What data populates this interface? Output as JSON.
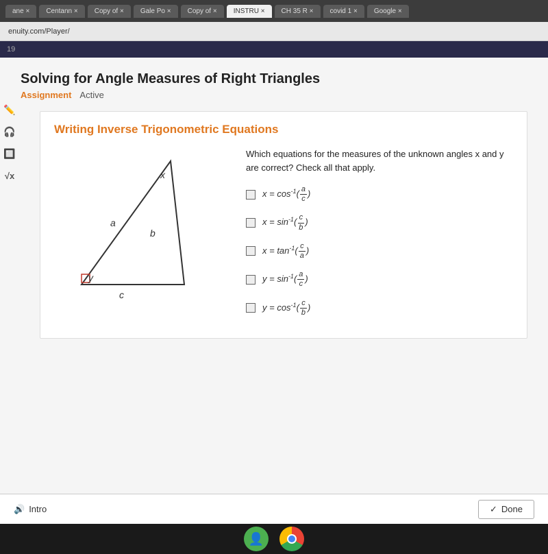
{
  "browser": {
    "tabs": [
      {
        "label": "ane",
        "active": false
      },
      {
        "label": "Centann",
        "active": false
      },
      {
        "label": "Copy of",
        "active": false
      },
      {
        "label": "Gale Po",
        "active": false
      },
      {
        "label": "Copy of",
        "active": false
      },
      {
        "label": "INSTRU",
        "active": false
      },
      {
        "label": "CH 35 R",
        "active": false
      },
      {
        "label": "covid 1",
        "active": false
      },
      {
        "label": "Google",
        "active": false
      }
    ],
    "address": "enuity.com/Player/"
  },
  "page": {
    "number": "19",
    "title": "Solving for Angle Measures of Right Triangles",
    "assignment_label": "Assignment",
    "active_label": "Active"
  },
  "card": {
    "heading": "Writing Inverse Trigonometric Equations",
    "question": "Which equations for the measures of the unknown angles x and y are correct? Check all that apply.",
    "answers": [
      {
        "id": 1,
        "text": "x = cos⁻¹(a/c)"
      },
      {
        "id": 2,
        "text": "x = sin⁻¹(c/b)"
      },
      {
        "id": 3,
        "text": "x = tan⁻¹(c/a)"
      },
      {
        "id": 4,
        "text": "y = sin⁻¹(a/c)"
      },
      {
        "id": 5,
        "text": "y = cos⁻¹(c/b)"
      }
    ]
  },
  "bottom_bar": {
    "intro_label": "Intro",
    "done_label": "Done"
  },
  "sidebar_icons": [
    "pencil",
    "headphones",
    "calculator",
    "sqrt"
  ],
  "taskbar": {
    "person_icon": "👤",
    "chrome_icon": "chrome"
  }
}
